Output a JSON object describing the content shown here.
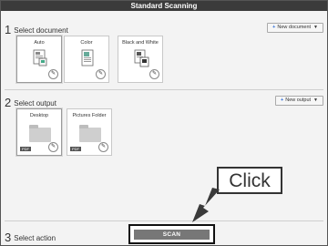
{
  "window": {
    "title": "Standard Scanning"
  },
  "select_document": {
    "number": "1",
    "heading": "Select document",
    "new_button": "New document",
    "cards": [
      {
        "label": "Auto",
        "icon": "auto-document-icon",
        "selected": true
      },
      {
        "label": "Color",
        "icon": "color-document-icon",
        "selected": false
      },
      {
        "label": "Black and White",
        "icon": "bw-document-icon",
        "selected": false
      }
    ]
  },
  "select_output": {
    "number": "2",
    "heading": "Select output",
    "new_button": "New output",
    "cards": [
      {
        "label": "Desktop",
        "icon": "folder-icon",
        "tag": "PDF"
      },
      {
        "label": "Pictures Folder",
        "icon": "folder-icon",
        "tag": "PDF"
      }
    ]
  },
  "select_action": {
    "number": "3",
    "heading": "Select action",
    "scan_button": "SCAN"
  },
  "callout": {
    "text": "Click"
  },
  "colors": {
    "titlebar": "#3b3b3b",
    "scan_button": "#777777",
    "accent_plus": "#2b6bd8"
  }
}
